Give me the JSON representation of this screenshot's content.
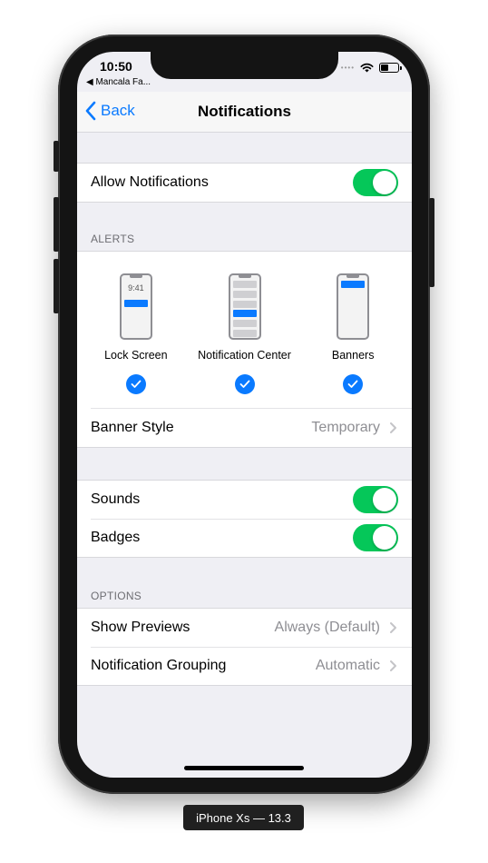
{
  "status_bar": {
    "time": "10:50",
    "back_app": "◀ Mancala Fa...",
    "signal": "••••"
  },
  "nav": {
    "back_label": "Back",
    "title": "Notifications"
  },
  "allow_notifications": {
    "label": "Allow Notifications",
    "enabled": true
  },
  "alerts_section": {
    "header": "ALERTS",
    "options": [
      {
        "label": "Lock Screen",
        "preview_time": "9:41",
        "checked": true
      },
      {
        "label": "Notification Center",
        "checked": true
      },
      {
        "label": "Banners",
        "checked": true
      }
    ],
    "banner_style": {
      "label": "Banner Style",
      "value": "Temporary"
    }
  },
  "sound_badges": [
    {
      "label": "Sounds",
      "enabled": true
    },
    {
      "label": "Badges",
      "enabled": true
    }
  ],
  "options_section": {
    "header": "OPTIONS",
    "rows": [
      {
        "label": "Show Previews",
        "value": "Always (Default)"
      },
      {
        "label": "Notification Grouping",
        "value": "Automatic"
      }
    ]
  },
  "device_label": "iPhone Xs — 13.3",
  "colors": {
    "accent": "#0a7aff",
    "toggle_on": "#05c759",
    "background": "#efeff4"
  }
}
